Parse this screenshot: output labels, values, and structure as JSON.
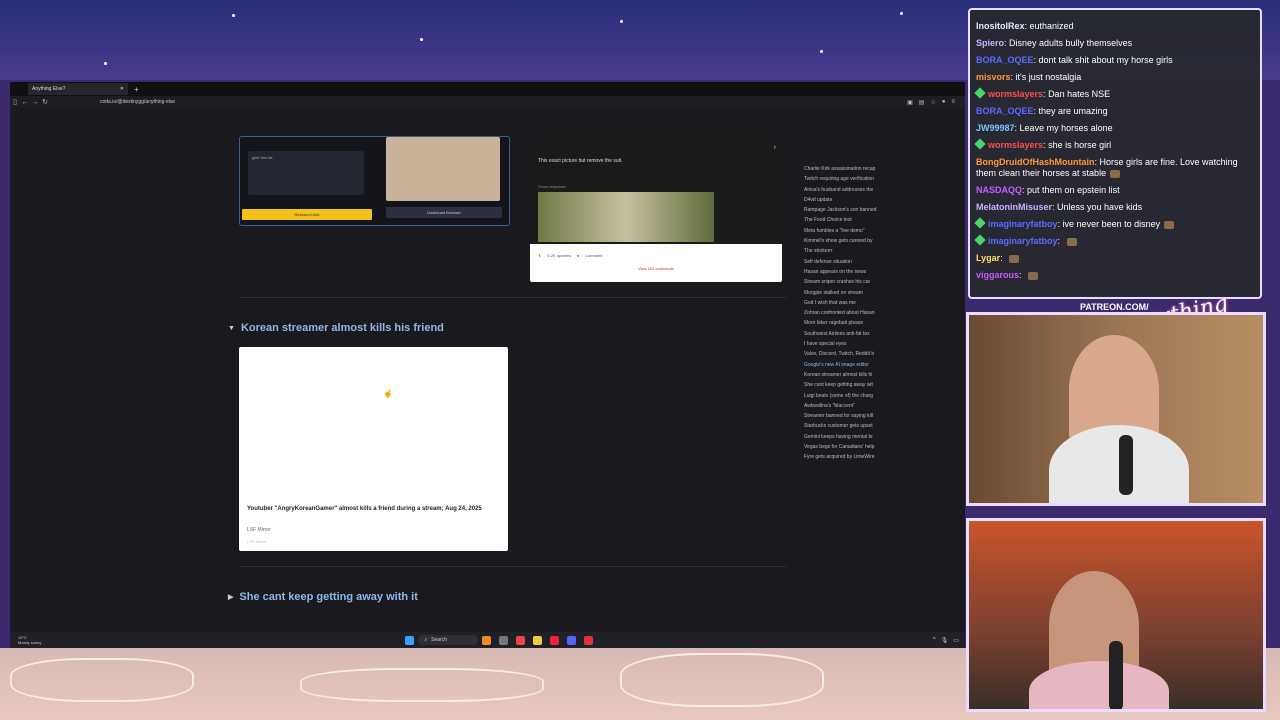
{
  "browser": {
    "tab_title": "Anything Else?",
    "url": "coda.io/@destinygg/anything-else"
  },
  "content": {
    "prev_card": {
      "primary_btn": "Research Ads",
      "secondary_btn": "Download Browser",
      "caption": "give him fat"
    },
    "right_card": {
      "text": "This exact picture but remove the suit.",
      "label": "Show response",
      "upvotes": "5.2K upvotes",
      "comments": "Comment",
      "view_link": "View 153 comments"
    },
    "section1": {
      "title": "Korean streamer almost kills his friend",
      "card_desc": "Youtuber \"AngryKoreanGamer\" almost kills a friend during a stream; Aug 24, 2025",
      "card_source": "LSF Mirror",
      "card_source_sub": "LSF Mirror"
    },
    "section2": {
      "title": "She cant keep getting away with it"
    },
    "toc": [
      "Charlie Kirk assassination recap",
      "Twitch requiring age verification",
      "Anisa's husband addresses the",
      "D4vd update",
      "Rampage Jackson's son banned",
      "The Food Choice test",
      "Meta fumbles a \"live demo\"",
      "Kimmel's show gets canned by",
      "The strokerrr",
      "Self defense situation",
      "Hasan appears on the news",
      "Stream sniper crashes his car",
      "Morgpie stalked on stream",
      "God I wish that was me",
      "Zohran confronted about Hasan",
      "More biker ragebait please",
      "Southwest Airlines anti-fat tax",
      "I have special eyes",
      "Valve, Discord, Twitch, Reddit b",
      "Google's new AI image editor",
      "Korean streamer almost kills hi",
      "She cant keep getting away wit",
      "Luigi beats (some of) the charg",
      "Awkwafina's \"blaccent\"",
      "Streamer banned for saying kill",
      "Starbucks customer gets upset",
      "Gemini keeps having mental br",
      "Vegas begs for Canadians' help",
      "Fyre gets acquired by LimeWire"
    ],
    "toc_active_index": 19
  },
  "taskbar": {
    "weather_temp": "19°C",
    "weather_desc": "Mostly sunny",
    "search": "Search"
  },
  "chat": [
    {
      "user": "InositolRex",
      "text": "euthanized",
      "color": "#e8e8ff",
      "badge": false,
      "emote": false
    },
    {
      "user": "Spiero",
      "text": "Disney adults bully themselves",
      "color": "#c7b3ff",
      "badge": false,
      "emote": false
    },
    {
      "user": "BORA_OQEE",
      "text": "dont talk shit about my horse girls",
      "color": "#5b6bff",
      "badge": false,
      "emote": false
    },
    {
      "user": "misvors",
      "text": "it's just nostalgia",
      "color": "#ff9a3c",
      "badge": false,
      "emote": false
    },
    {
      "user": "wormslayers",
      "text": "Dan hates NSE",
      "color": "#ff4d4d",
      "badge": true,
      "emote": false
    },
    {
      "user": "BORA_OQEE",
      "text": "they are umazing",
      "color": "#5b6bff",
      "badge": false,
      "emote": false
    },
    {
      "user": "JW99987",
      "text": "Leave my horses alone",
      "color": "#7ec3ff",
      "badge": false,
      "emote": false
    },
    {
      "user": "wormslayers",
      "text": "she is horse girl",
      "color": "#ff4d4d",
      "badge": true,
      "emote": false
    },
    {
      "user": "BongDruidOfHashMountain",
      "text": "Horse girls are fine. Love watching them clean their horses at stable",
      "color": "#ff9a3c",
      "badge": false,
      "emote": true
    },
    {
      "user": "NASDAQQ",
      "text": "put them on epstein list",
      "color": "#c85cff",
      "badge": false,
      "emote": false
    },
    {
      "user": "MelatoninMisuser",
      "text": "Unless you have kids",
      "color": "#c7b3ff",
      "badge": false,
      "emote": false
    },
    {
      "user": "imaginaryfatboy",
      "text": "ive never been to disney",
      "color": "#5b6bff",
      "badge": true,
      "emote": true
    },
    {
      "user": "imaginaryfatboy",
      "text": "",
      "color": "#5b6bff",
      "badge": true,
      "emote": true
    },
    {
      "user": "Lygar",
      "text": "",
      "color": "#ffe066",
      "badge": false,
      "emote": true
    },
    {
      "user": "viggarous",
      "text": "",
      "color": "#c85cff",
      "badge": false,
      "emote": true
    }
  ],
  "overlay": {
    "patreon": "PATREON.COM/",
    "brand": "Anything Else?"
  }
}
